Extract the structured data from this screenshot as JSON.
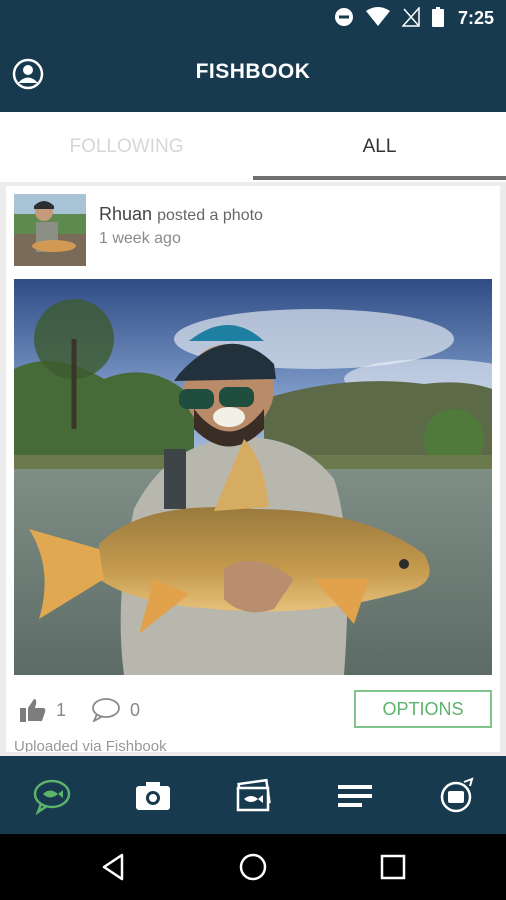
{
  "status_bar": {
    "time": "7:25",
    "icons": [
      "do-not-disturb-icon",
      "wifi-icon",
      "no-signal-icon",
      "battery-icon"
    ]
  },
  "app_bar": {
    "title": "FISHBOOK",
    "profile_icon": "profile-icon"
  },
  "tabs": [
    {
      "label": "FOLLOWING",
      "active": false
    },
    {
      "label": "ALL",
      "active": true
    }
  ],
  "post": {
    "author": "Rhuan",
    "action": "posted a photo",
    "time_ago": "1 week ago",
    "likes": "1",
    "comments": "0",
    "options_label": "OPTIONS",
    "upload_note": "Uploaded via Fishbook"
  },
  "bottom_nav": [
    "fish-chat-icon",
    "camera-icon",
    "photos-icon",
    "list-icon",
    "fish-badge-icon"
  ],
  "system_nav": [
    "back-icon",
    "home-icon",
    "recents-icon"
  ],
  "colors": {
    "primary": "#183a4f",
    "accent_green": "#5cb36b",
    "tab_inactive": "#d6d6d6"
  }
}
